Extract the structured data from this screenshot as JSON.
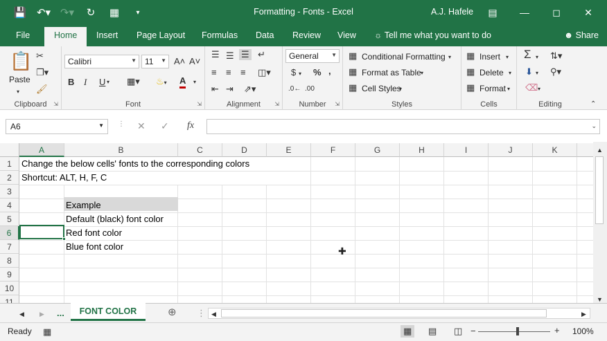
{
  "window": {
    "title": "Formatting - Fonts  -  Excel",
    "user": "A.J. Hafele"
  },
  "qat_icons": [
    "save-icon",
    "undo-icon",
    "redo-icon",
    "autosave-icon",
    "form-icon",
    "customize-icon"
  ],
  "tabs": [
    "File",
    "Home",
    "Insert",
    "Page Layout",
    "Formulas",
    "Data",
    "Review",
    "View"
  ],
  "active_tab": "Home",
  "tell_me": "Tell me what you want to do",
  "share_label": "Share",
  "ribbon": {
    "clipboard": {
      "paste_label": "Paste",
      "group_label": "Clipboard"
    },
    "font": {
      "font_name": "Calibri",
      "font_size": "11",
      "bold": "B",
      "italic": "I",
      "underline": "U",
      "group_label": "Font"
    },
    "alignment": {
      "group_label": "Alignment"
    },
    "number": {
      "format": "General",
      "currency": "$",
      "percent": "%",
      "comma": ",",
      "inc_decimal": ".0←",
      "dec_decimal": ".00",
      "group_label": "Number"
    },
    "styles": {
      "conditional": "Conditional Formatting",
      "format_table": "Format as Table",
      "cell_styles": "Cell Styles",
      "group_label": "Styles"
    },
    "cells": {
      "insert": "Insert",
      "delete": "Delete",
      "format": "Format",
      "group_label": "Cells"
    },
    "editing": {
      "group_label": "Editing"
    }
  },
  "formula_bar": {
    "name_box": "A6",
    "formula": ""
  },
  "columns": [
    "A",
    "B",
    "C",
    "D",
    "E",
    "F",
    "G",
    "H",
    "I",
    "J",
    "K"
  ],
  "selected_column": "A",
  "rows": [
    "1",
    "2",
    "3",
    "4",
    "5",
    "6",
    "7",
    "8",
    "9",
    "10",
    "11"
  ],
  "selected_row": "6",
  "cells": {
    "A1": "Change the below cells' fonts to the corresponding colors",
    "A2": "Shortcut: ALT, H, F, C",
    "B4": "Example",
    "B5": "Default (black) font color",
    "B6": "Red font color",
    "B7": "Blue font color"
  },
  "sheet": {
    "tab_label": "FONT COLOR",
    "ellipsis": "..."
  },
  "status": {
    "ready": "Ready",
    "zoom": "100%"
  },
  "colors": {
    "excel_green": "#217346",
    "header_fill": "#d9d9d9"
  }
}
